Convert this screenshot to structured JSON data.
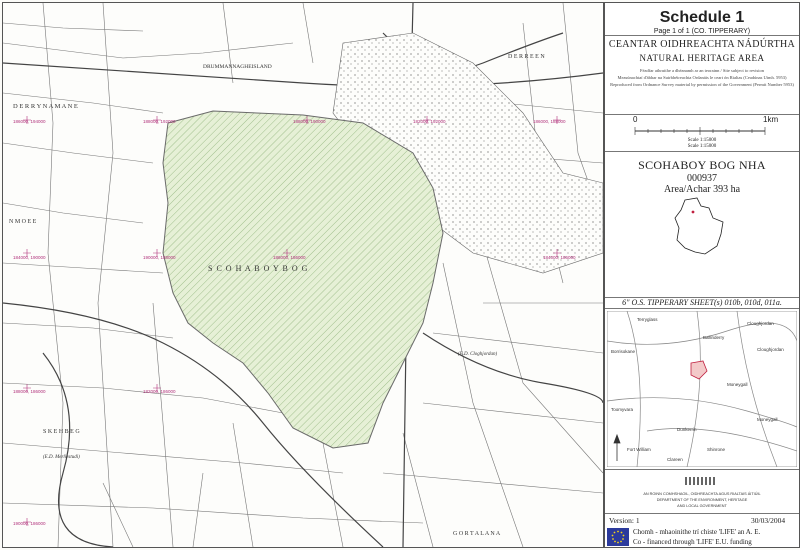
{
  "header": {
    "title": "Schedule 1",
    "page": "Page 1 of 1 (CO. TIPPERARY)",
    "irish_title": "CEANTAR OIDHREACHTA NÁDÚRTHA",
    "english_title": "NATURAL HERITAGE AREA",
    "note1": "Féadfar athruithe a dhéanamh ar an teorainn / Site subject to revision",
    "note2": "Measúnachtaí d'ábhar na Suirbhéireachta Ordanáis le ceart ón Rialtas (Ceadúnas Uimh. 5953)",
    "note3": "Reproduced from Ordnance Survey material by permission of the Government (Permit Number 5953)"
  },
  "scale": {
    "zero": "0",
    "end_label": "1km",
    "scale1": "Scale 1:15000",
    "scale2": "Scale 1:15000"
  },
  "site": {
    "name": "SCOHABOY BOG NHA",
    "code": "000937",
    "area": "Area/Achar 393 ha"
  },
  "sheets": "6\" O.S.  TIPPERARY  SHEET(s) 010b, 010d, 011a.",
  "locator_places": [
    "Terryglass",
    "Borrisokane",
    "Ballinderry",
    "Cloughjordan",
    "Moneygall",
    "Toomyvara",
    "Dunkerrin",
    "Moneygall",
    "Cloughjordan",
    "Shinrone",
    "Fort William",
    "Clareen"
  ],
  "department": {
    "line1": "AN ROINN COMHSHAOIL, OIDHREACHTA AGUS RIALTAIS ÁITIÚIL",
    "line2": "DEPARTMENT OF THE ENVIRONMENT, HERITAGE",
    "line3": "AND LOCAL GOVERNMENT"
  },
  "version": "Version: 1",
  "date": "30/03/2004",
  "eu_line1": "Chomh - mhaoinithe trí chiste 'LIFE' an A. E.",
  "eu_line2": "Co - financed through 'LIFE' E.U. funding",
  "map_labels": {
    "bog": "S C O H A B O Y     B O G",
    "townland1": "D E R R Y N A M A N E",
    "townland2": "DRUMMANNAGHEISLAND",
    "townland3": "D E R R E E N",
    "townland4": "N M O E E",
    "townland5": "S K E H B E G",
    "townland6": "G O R T A L A N A",
    "ed1": "(E.D. Cloghjordan)",
    "ed2": "(E.D. Merliestudi)"
  },
  "grid_labels": [
    "186000, 194000",
    "188000, 192000",
    "188000, 190000",
    "182000, 192000",
    "186000, 188000",
    "184000, 190000",
    "190000, 188000",
    "186000, 186000",
    "184000, 186000",
    "188000, 186000",
    "182000, 186000",
    "190000, 186000"
  ],
  "colors": {
    "nha_fill": "#e6f0d6",
    "nha_hatch": "#8fb47a",
    "grid_label": "#b0307a",
    "eu_blue": "#2b3a9c"
  }
}
